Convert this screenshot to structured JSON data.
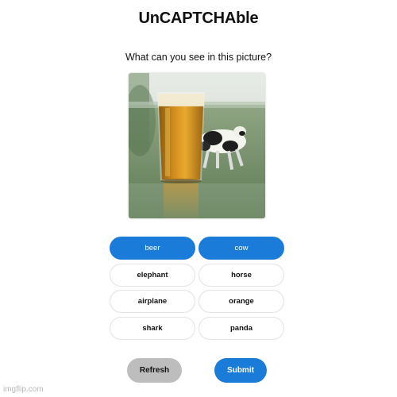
{
  "title": "UnCAPTCHAble",
  "question": "What can you see in this picture?",
  "options": [
    {
      "label": "beer",
      "selected": true
    },
    {
      "label": "cow",
      "selected": true
    },
    {
      "label": "elephant",
      "selected": false
    },
    {
      "label": "horse",
      "selected": false
    },
    {
      "label": "airplane",
      "selected": false
    },
    {
      "label": "orange",
      "selected": false
    },
    {
      "label": "shark",
      "selected": false
    },
    {
      "label": "panda",
      "selected": false
    }
  ],
  "buttons": {
    "refresh": "Refresh",
    "submit": "Submit"
  },
  "watermark": "imgflip.com",
  "colors": {
    "accent": "#1b7bd8",
    "refresh_bg": "#bdbdbd",
    "option_border": "#e2e2e2"
  }
}
